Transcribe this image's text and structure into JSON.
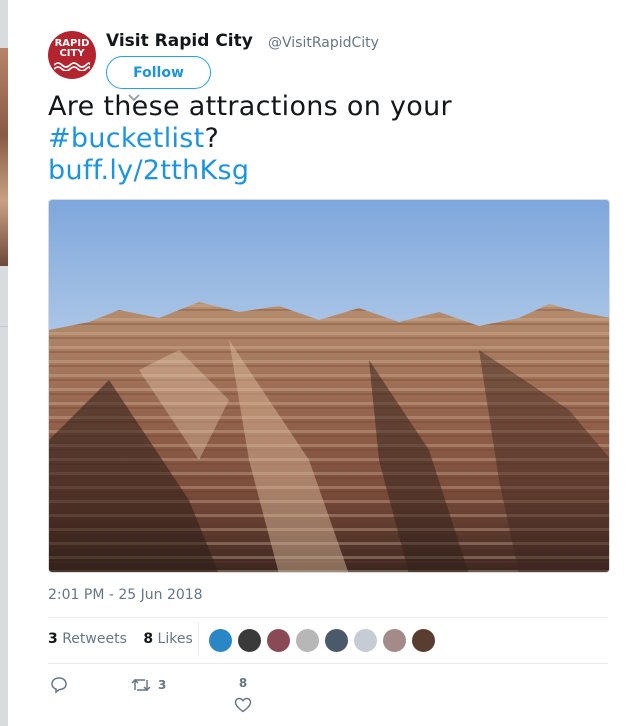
{
  "author": {
    "display_name": "Visit Rapid City",
    "handle": "@VisitRapidCity",
    "avatar_logo_line1": "RAPID",
    "avatar_logo_line2": "CITY"
  },
  "follow_button": {
    "label": "Follow"
  },
  "tweet": {
    "text_plain": "Are these attractions on your",
    "hashtag": "#bucketlist",
    "after_hashtag": "?",
    "link": "buff.ly/2tthKsg"
  },
  "timestamp": "2:01 PM - 25 Jun 2018",
  "stats": {
    "retweets_count": "3",
    "retweets_label": "Retweets",
    "likes_count": "8",
    "likes_label": "Likes"
  },
  "likers": [
    {
      "color": "#2b86c5"
    },
    {
      "color": "#3a3a3a"
    },
    {
      "color": "#8a4a55"
    },
    {
      "color": "#b7b7b7"
    },
    {
      "color": "#4a5a6a"
    },
    {
      "color": "#c6ccd3"
    },
    {
      "color": "#a58a8a"
    },
    {
      "color": "#5a3d30"
    }
  ],
  "actions": {
    "reply_icon": "reply-icon",
    "retweet_icon": "retweet-icon",
    "retweet_count": "3",
    "like_icon": "heart-icon",
    "like_count": "8"
  },
  "colors": {
    "accent": "#1b95e0",
    "brand_red": "#b4242e",
    "text": "#14171a",
    "muted": "#657786"
  }
}
